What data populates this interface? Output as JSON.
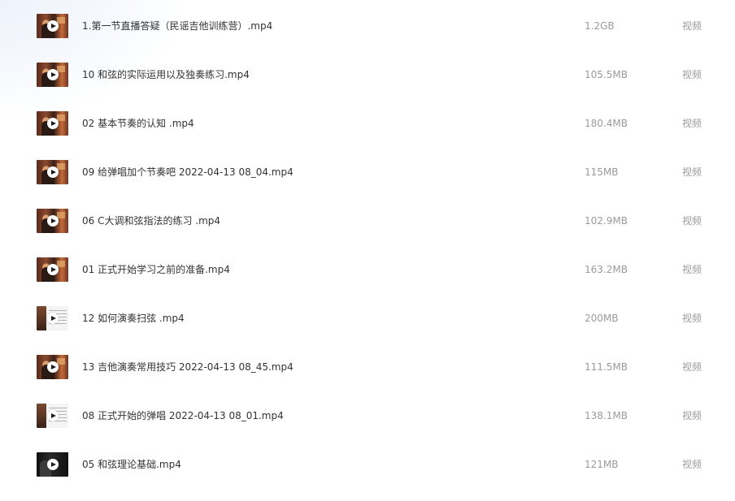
{
  "files": [
    {
      "name": "1.第一节直播答疑（民谣吉他训练营）.mp4",
      "size": "1.2GB",
      "type": "视频",
      "thumb": "stage"
    },
    {
      "name": "10 和弦的实际运用以及独奏练习.mp4",
      "size": "105.5MB",
      "type": "视频",
      "thumb": "stage"
    },
    {
      "name": "02 基本节奏的认知 .mp4",
      "size": "180.4MB",
      "type": "视频",
      "thumb": "stage"
    },
    {
      "name": "09 给弹唱加个节奏吧 2022-04-13 08_04.mp4",
      "size": "115MB",
      "type": "视频",
      "thumb": "stage"
    },
    {
      "name": "06 C大调和弦指法的练习 .mp4",
      "size": "102.9MB",
      "type": "视频",
      "thumb": "stage"
    },
    {
      "name": "01 正式开始学习之前的准备.mp4",
      "size": "163.2MB",
      "type": "视频",
      "thumb": "stage"
    },
    {
      "name": "12 如何演奏扫弦 .mp4",
      "size": "200MB",
      "type": "视频",
      "thumb": "sheet"
    },
    {
      "name": "13 吉他演奏常用技巧 2022-04-13 08_45.mp4",
      "size": "111.5MB",
      "type": "视频",
      "thumb": "stage"
    },
    {
      "name": "08 正式开始的弹唱 2022-04-13 08_01.mp4",
      "size": "138.1MB",
      "type": "视频",
      "thumb": "sheet"
    },
    {
      "name": "05 和弦理论基础.mp4",
      "size": "121MB",
      "type": "视频",
      "thumb": "dark"
    }
  ]
}
